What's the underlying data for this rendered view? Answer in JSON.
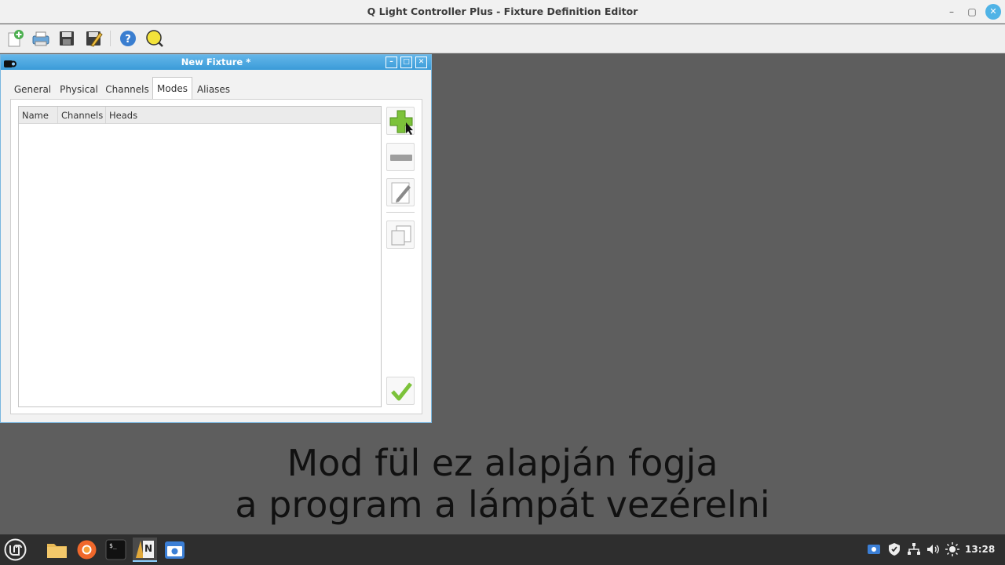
{
  "app": {
    "title": "Q Light Controller Plus - Fixture Definition Editor",
    "window_controls": {
      "minimize": "–",
      "maximize": "▢",
      "close": "✕"
    }
  },
  "toolbar": {
    "icons": [
      "new-fixture-icon",
      "open-icon",
      "save-icon",
      "save-as-icon",
      "help-icon",
      "about-icon"
    ]
  },
  "subwindow": {
    "title": "New Fixture *",
    "controls": {
      "minimize": "–",
      "maximize": "□",
      "close": "✕"
    },
    "tabs": [
      {
        "label": "General"
      },
      {
        "label": "Physical"
      },
      {
        "label": "Channels"
      },
      {
        "label": "Modes",
        "active": true
      },
      {
        "label": "Aliases"
      }
    ],
    "modes_table": {
      "columns": [
        "Name",
        "Channels",
        "Heads"
      ],
      "rows": []
    },
    "side_buttons": [
      "add-mode",
      "remove-mode",
      "edit-mode",
      "clone-mode"
    ]
  },
  "caption": {
    "line1": "Mod fül ez alapján fogja",
    "line2": "a program a lámpát vezérelni"
  },
  "taskbar": {
    "clock": "13:28",
    "apps": [
      "mint-menu-icon",
      "files-icon",
      "firefox-icon",
      "terminal-icon",
      "qlc-editor-icon",
      "screenshot-icon"
    ]
  },
  "colors": {
    "accent": "#3b9bd8",
    "desktop": "#5e5e5e",
    "add_green": "#7cc23a"
  }
}
